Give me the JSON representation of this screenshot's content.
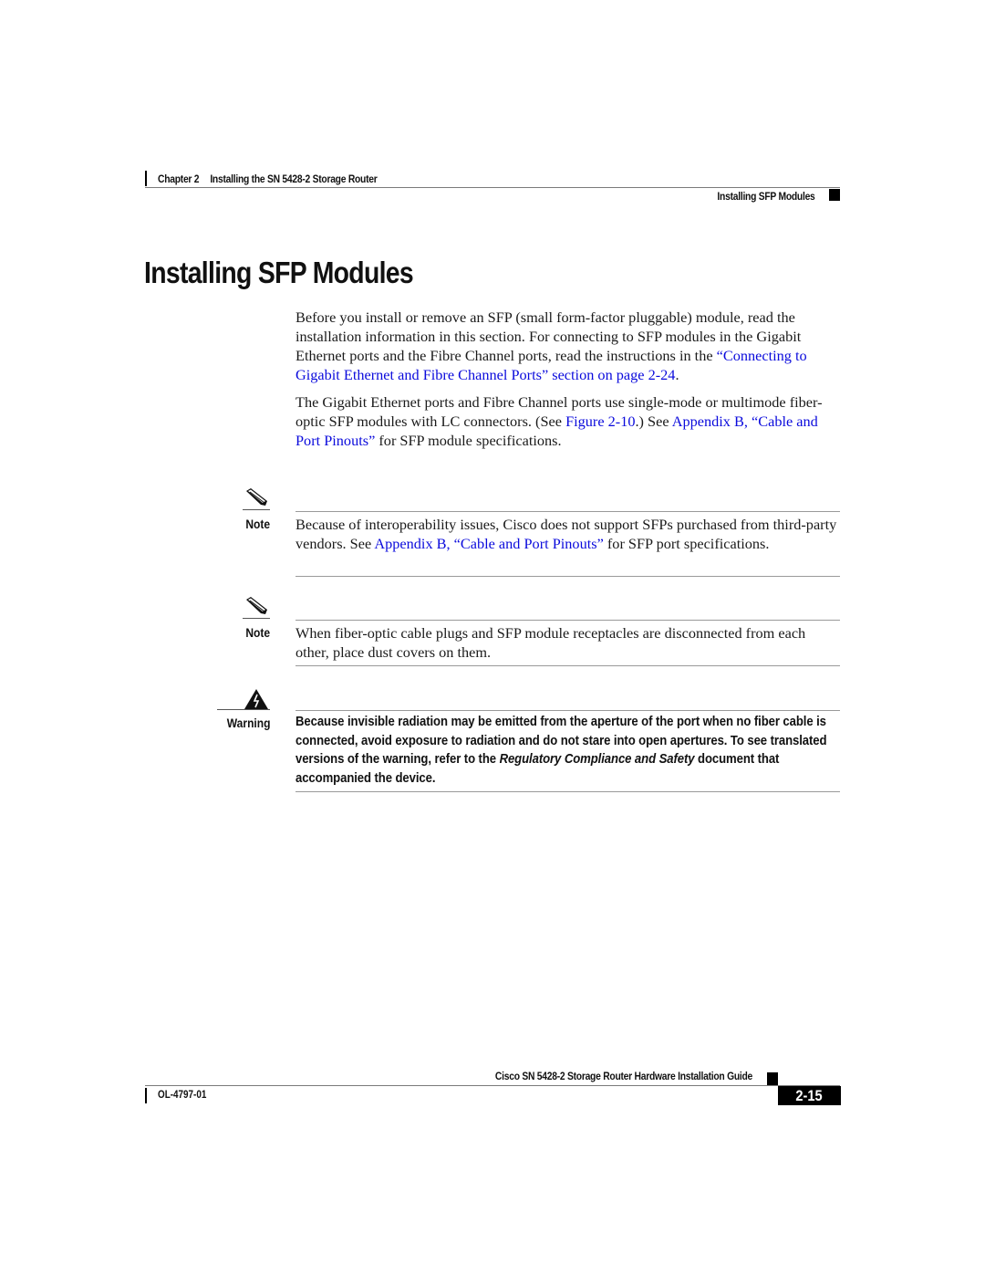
{
  "header": {
    "chapter_label": "Chapter 2",
    "chapter_title": "Installing the SN 5428-2 Storage Router",
    "section_title": "Installing SFP Modules"
  },
  "main": {
    "title": "Installing SFP Modules",
    "paragraph1": {
      "text": "Before you install or remove an SFP (small form-factor pluggable) module, read the installation information in this section. For connecting to SFP modules in the Gigabit Ethernet ports and the Fibre Channel ports, read the instructions in the ",
      "link": "“Connecting to Gigabit Ethernet and Fibre Channel Ports” section on page 2-24",
      "end": "."
    },
    "paragraph2": {
      "text_a": "The Gigabit Ethernet ports and Fibre Channel ports use single-mode or multimode fiber-optic SFP modules with LC connectors. (See ",
      "link_figure": "Figure 2-10",
      "text_b": ".) See ",
      "link_appendix": "Appendix B, “Cable and Port Pinouts”",
      "text_c": " for SFP module specifications."
    },
    "note1": {
      "label": "Note",
      "icon": "pencil-icon",
      "text_a": "Because of interoperability issues, Cisco does not support SFPs purchased from third-party vendors. See ",
      "link": "Appendix B, “Cable and Port Pinouts”",
      "text_b": " for SFP port specifications."
    },
    "note2": {
      "label": "Note",
      "icon": "pencil-icon",
      "text": "When fiber-optic cable plugs and SFP module receptacles are disconnected from each other, place dust covers on them."
    },
    "warning": {
      "label": "Warning",
      "icon": "warning-triangle-icon",
      "text_a": "Because invisible radiation may be emitted from the aperture of the port when no fiber cable is connected, avoid exposure to radiation and do not stare into open apertures. To see translated versions of the warning, refer to the ",
      "italic": "Regulatory Compliance and Safety",
      "text_b": " document that accompanied the device."
    }
  },
  "footer": {
    "guide_title": "Cisco SN 5428-2 Storage Router Hardware Installation Guide",
    "doc_number": "OL-4797-01",
    "page_number": "2-15"
  },
  "colors": {
    "link": "#0a0adc",
    "text": "#1a1a1a",
    "rule": "#9a9a9a"
  }
}
